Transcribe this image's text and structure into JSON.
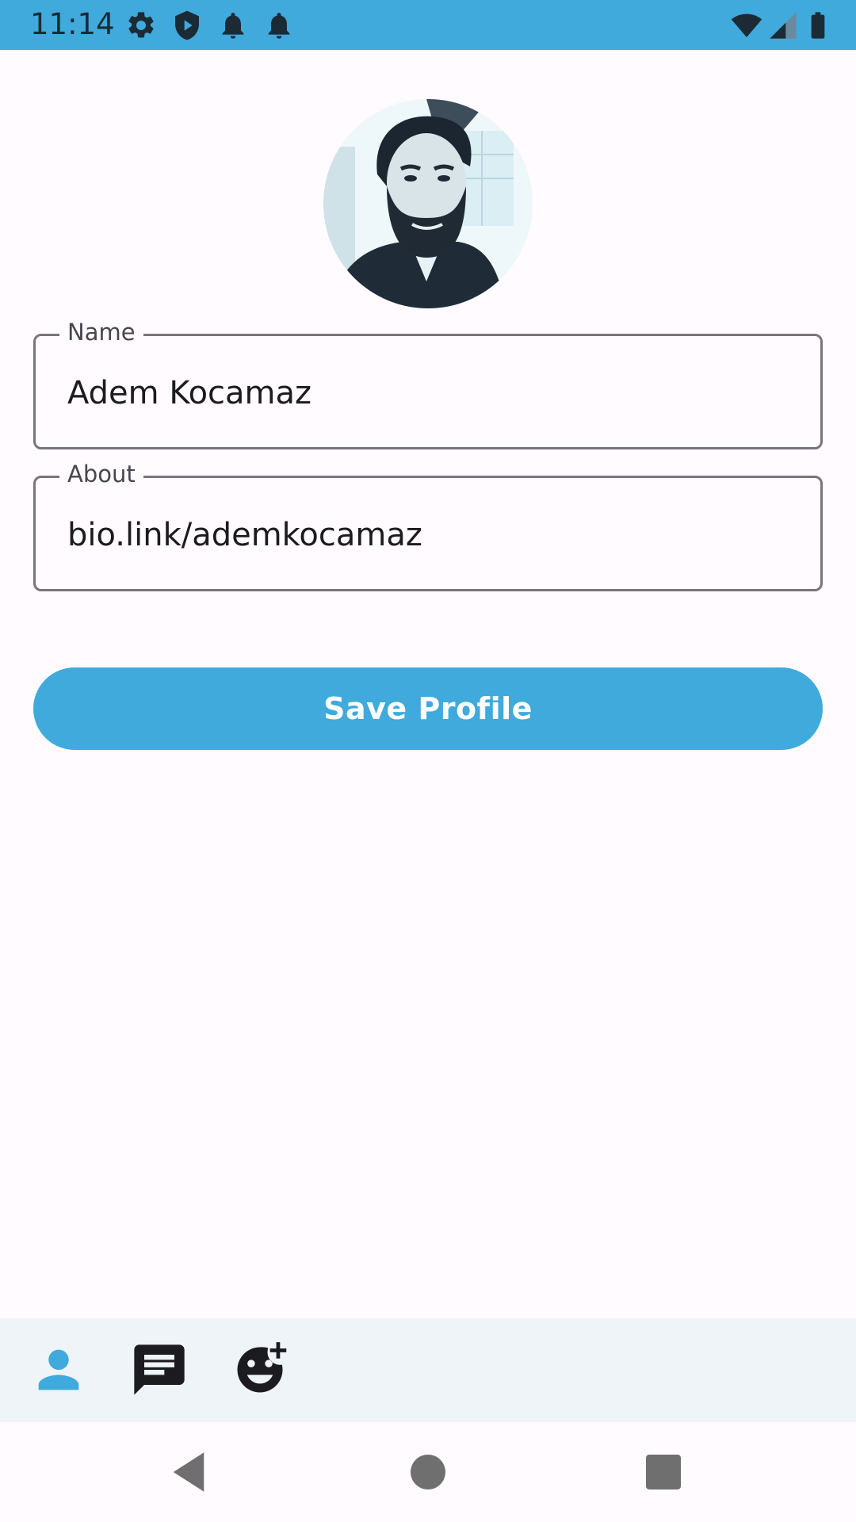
{
  "status_bar": {
    "time": "11:14",
    "icons_left": [
      "gear-icon",
      "shield-icon",
      "bell-icon",
      "bell-icon"
    ],
    "icons_right": [
      "wifi-icon",
      "signal-icon",
      "battery-icon"
    ],
    "background": "#3faadb"
  },
  "profile": {
    "avatar": "profile-photo"
  },
  "fields": {
    "name": {
      "label": "Name",
      "value": "Adem Kocamaz"
    },
    "about": {
      "label": "About",
      "value": "bio.link/ademkocamaz"
    }
  },
  "actions": {
    "save_label": "Save Profile",
    "accent": "#3faadb"
  },
  "bottom_nav": {
    "items": [
      {
        "icon": "person-icon",
        "selected": true
      },
      {
        "icon": "chat-icon",
        "selected": false
      },
      {
        "icon": "add-reaction-icon",
        "selected": false
      }
    ],
    "background": "#eef4f8"
  },
  "system_nav": {
    "buttons": [
      "back-icon",
      "home-icon",
      "recents-icon"
    ]
  }
}
